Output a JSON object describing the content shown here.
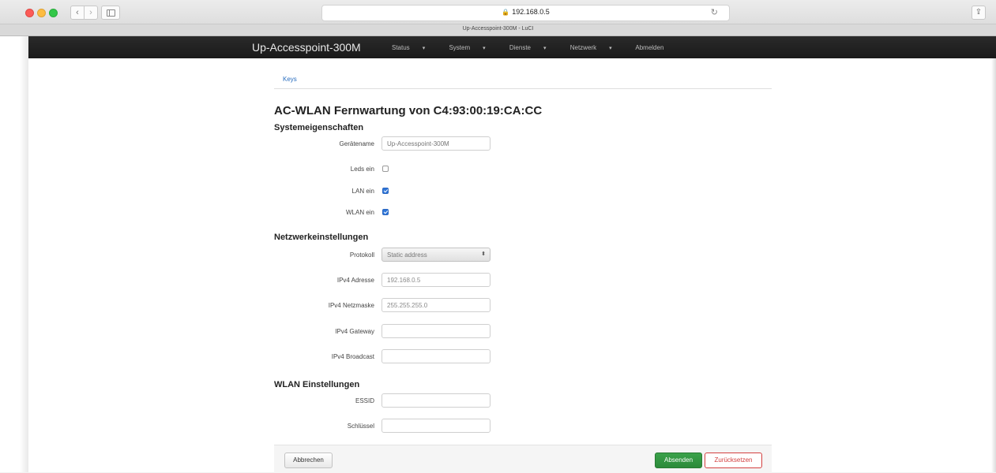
{
  "browser": {
    "url": "192.168.0.5",
    "tab_title": "Up-Accesspoint-300M - LuCI"
  },
  "header": {
    "brand": "Up-Accesspoint-300M",
    "menu": [
      "Status",
      "System",
      "Dienste",
      "Netzwerk",
      "Abmelden"
    ]
  },
  "tabs": {
    "keys": "Keys"
  },
  "page": {
    "title": "AC-WLAN Fernwartung von C4:93:00:19:CA:CC"
  },
  "system": {
    "title": "Systemeigenschaften",
    "devicename_label": "Gerätename",
    "devicename_placeholder": "Up-Accesspoint-300M",
    "leds_label": "Leds ein",
    "leds_checked": false,
    "lan_label": "LAN ein",
    "lan_checked": true,
    "wlan_label": "WLAN ein",
    "wlan_checked": true
  },
  "network": {
    "title": "Netzwerkeinstellungen",
    "protocol_label": "Protokoll",
    "protocol_value": "Static address",
    "ipv4_address_label": "IPv4 Adresse",
    "ipv4_address_value": "192.168.0.5",
    "ipv4_netmask_label": "IPv4 Netzmaske",
    "ipv4_netmask_value": "255.255.255.0",
    "ipv4_gateway_label": "IPv4 Gateway",
    "ipv4_gateway_value": "",
    "ipv4_broadcast_label": "IPv4 Broadcast",
    "ipv4_broadcast_value": ""
  },
  "wlan": {
    "title": "WLAN Einstellungen",
    "essid_label": "ESSID",
    "essid_value": "",
    "key_label": "Schlüssel",
    "key_value": ""
  },
  "actions": {
    "cancel": "Abbrechen",
    "submit": "Absenden",
    "reset": "Zurücksetzen"
  }
}
